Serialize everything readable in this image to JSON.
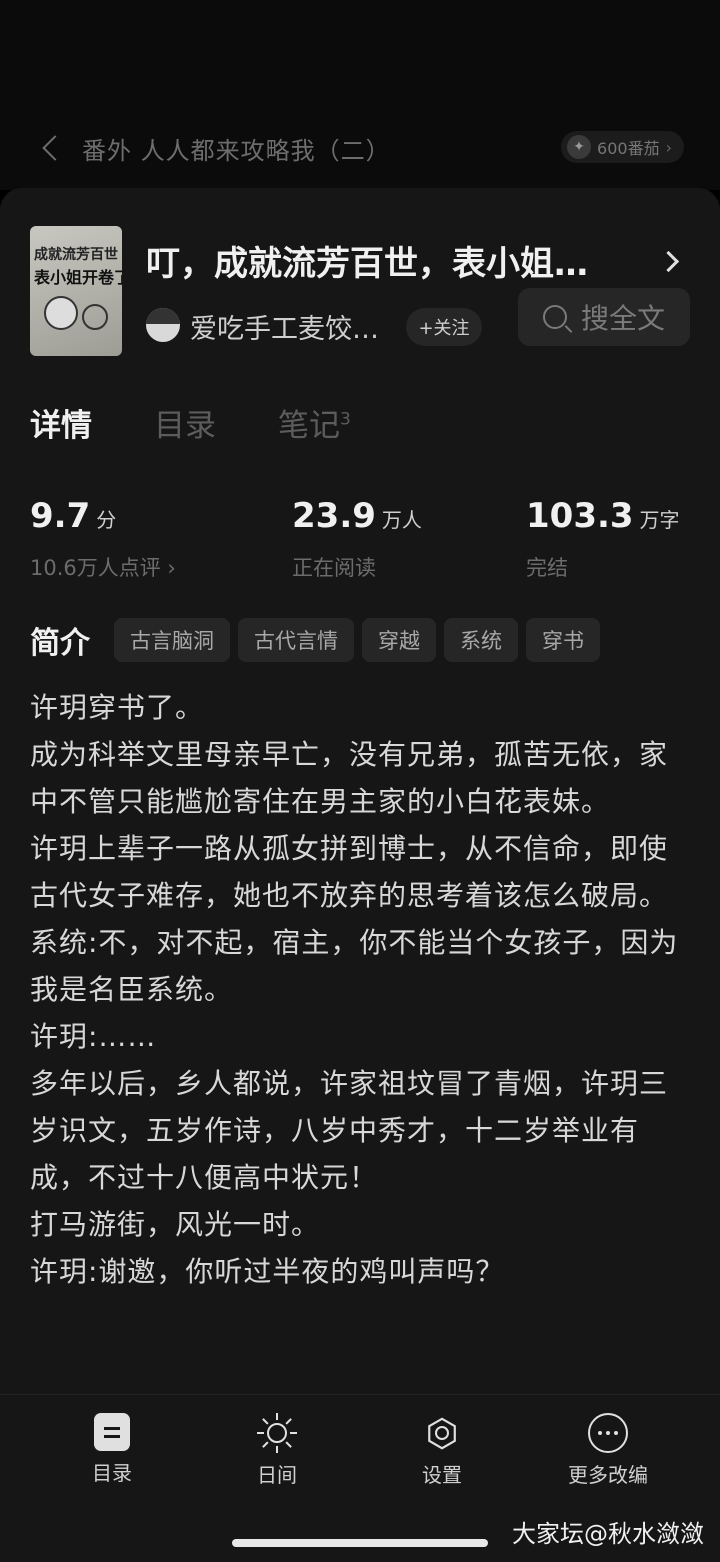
{
  "header": {
    "chapter_title": "番外 人人都来攻略我（二）",
    "coins_label": "600番茄"
  },
  "book": {
    "title": "叮，成就流芳百世，表小姐…",
    "cover_text_line1": "成就流芳百世",
    "cover_text_line2": "表小姐开卷了",
    "author": "爱吃手工麦饺…",
    "follow_label": "+关注",
    "search_label": "搜全文"
  },
  "tabs": [
    {
      "label": "详情",
      "active": true
    },
    {
      "label": "目录",
      "active": false
    },
    {
      "label": "笔记",
      "badge": "3",
      "active": false
    }
  ],
  "stats": [
    {
      "value": "9.7",
      "unit": "分",
      "sub": "10.6万人点评 ›"
    },
    {
      "value": "23.9",
      "unit": "万人",
      "sub": "正在阅读"
    },
    {
      "value": "103.3",
      "unit": "万字",
      "sub": "完结"
    }
  ],
  "intro": {
    "label": "简介",
    "tags": [
      "古言脑洞",
      "古代言情",
      "穿越",
      "系统",
      "穿书"
    ]
  },
  "synopsis": [
    "许玥穿书了。",
    "成为科举文里母亲早亡，没有兄弟，孤苦无依，家中不管只能尴尬寄住在男主家的小白花表妹。",
    "许玥上辈子一路从孤女拼到博士，从不信命，即使古代女子难存，她也不放弃的思考着该怎么破局。",
    "系统:不，对不起，宿主，你不能当个女孩子，因为我是名臣系统。",
    "许玥:……",
    "多年以后，乡人都说，许家祖坟冒了青烟，许玥三岁识文，五岁作诗，八岁中秀才，十二岁举业有成，不过十八便高中状元！",
    "打马游街，风光一时。",
    "许玥:谢邀，你听过半夜的鸡叫声吗？"
  ],
  "bottom_nav": [
    {
      "label": "目录",
      "icon": "toc-icon"
    },
    {
      "label": "日间",
      "icon": "sun-icon"
    },
    {
      "label": "设置",
      "icon": "settings-icon"
    },
    {
      "label": "更多改编",
      "icon": "more-icon"
    }
  ],
  "watermark": "大家坛@秋水潋潋"
}
